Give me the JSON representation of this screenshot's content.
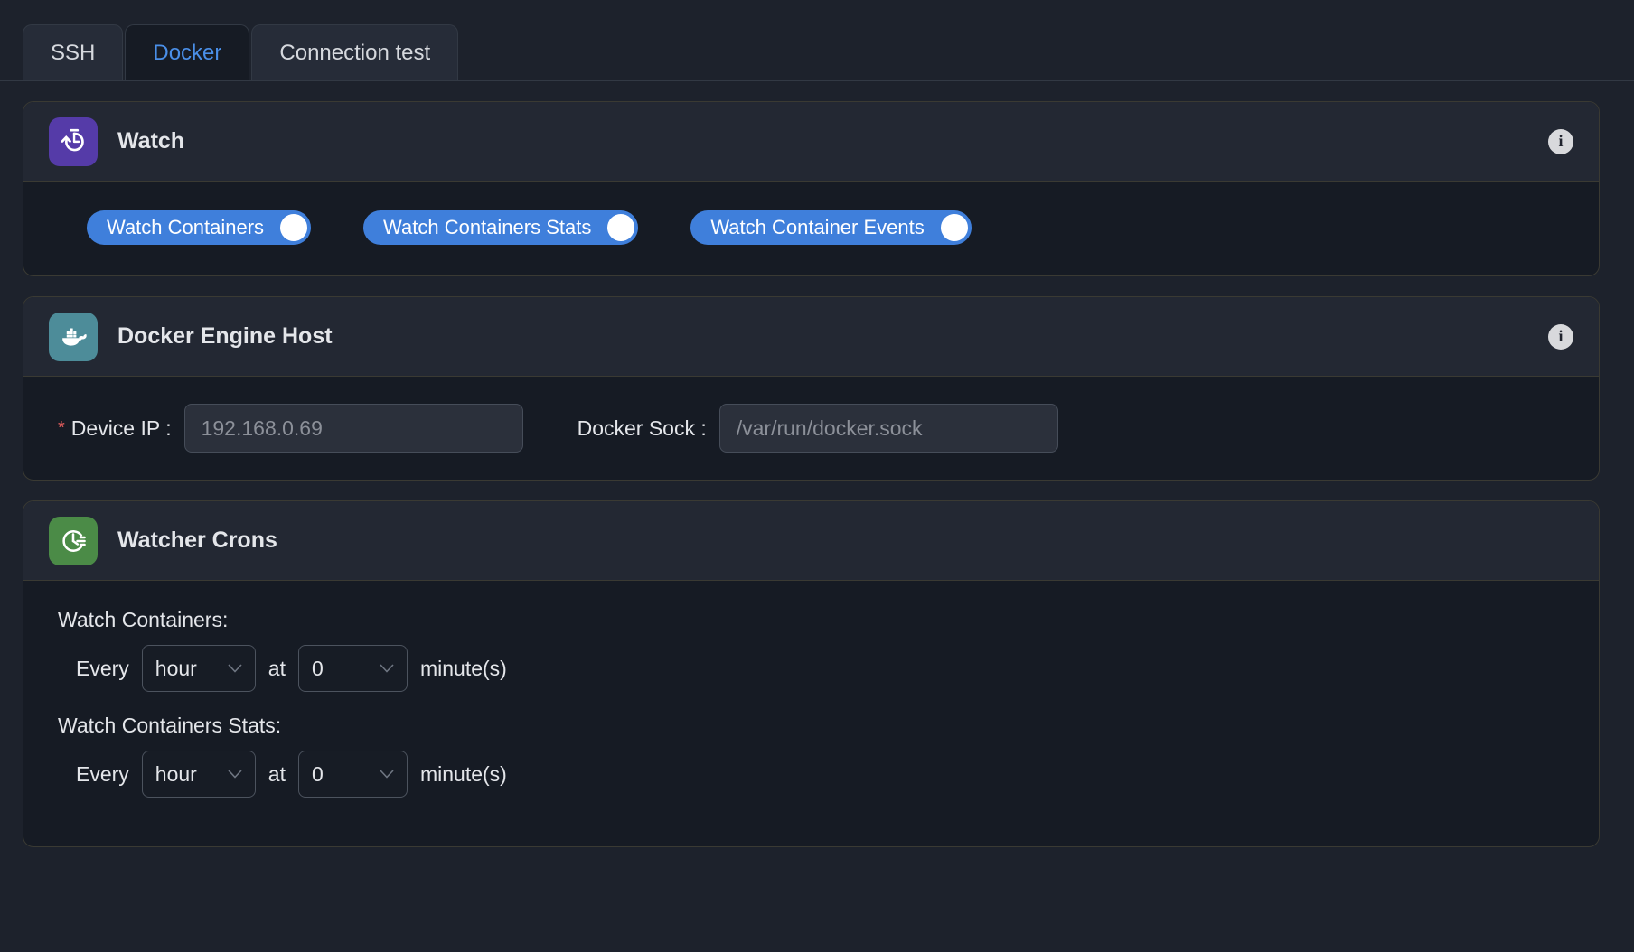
{
  "tabs": [
    {
      "label": "SSH",
      "active": false
    },
    {
      "label": "Docker",
      "active": true
    },
    {
      "label": "Connection test",
      "active": false
    }
  ],
  "cards": {
    "watch": {
      "title": "Watch",
      "icon": "stopwatch-icon",
      "icon_color": "#553ba8",
      "info_label": "i",
      "toggles": [
        {
          "label": "Watch Containers",
          "on": true
        },
        {
          "label": "Watch Containers Stats",
          "on": true
        },
        {
          "label": "Watch Container Events",
          "on": true
        }
      ]
    },
    "docker_engine_host": {
      "title": "Docker Engine Host",
      "icon": "docker-whale-icon",
      "icon_color": "#4d8c99",
      "info_label": "i",
      "fields": {
        "device_ip": {
          "label": "Device IP :",
          "required_marker": "*",
          "value": "",
          "placeholder": "192.168.0.69"
        },
        "docker_sock": {
          "label": "Docker Sock :",
          "value": "",
          "placeholder": "/var/run/docker.sock"
        }
      }
    },
    "watcher_crons": {
      "title": "Watcher Crons",
      "icon": "clock-schedule-icon",
      "icon_color": "#4b8b47",
      "rows": [
        {
          "label": "Watch Containers:",
          "prefix": "Every",
          "unit_value": "hour",
          "middle": "at",
          "minute_value": "0",
          "suffix": "minute(s)"
        },
        {
          "label": "Watch Containers Stats:",
          "prefix": "Every",
          "unit_value": "hour",
          "middle": "at",
          "minute_value": "0",
          "suffix": "minute(s)"
        }
      ]
    }
  },
  "colors": {
    "accent_blue": "#3f7fdb",
    "tab_active_text": "#4a8fe8",
    "page_bg": "#1d222c",
    "card_bg": "#161b24",
    "card_header_bg": "#232833",
    "required_star": "#e05c5c"
  }
}
